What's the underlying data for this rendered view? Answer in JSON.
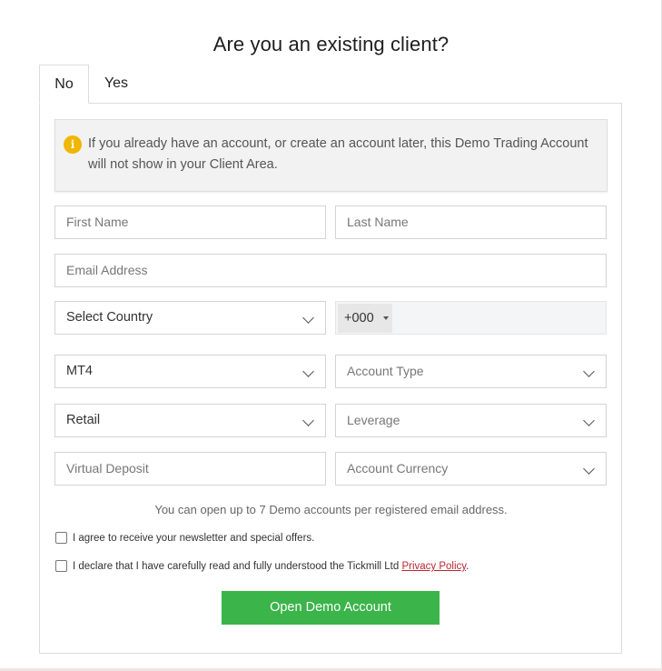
{
  "title": "Are you an existing client?",
  "tabs": {
    "no": "No",
    "yes": "Yes"
  },
  "notice": {
    "icon": "info-icon",
    "icon_glyph": "i",
    "text": "If you already have an account, or create an account later, this Demo Trading Account will not show in your Client Area."
  },
  "form": {
    "first_name_placeholder": "First Name",
    "last_name_placeholder": "Last Name",
    "email_placeholder": "Email Address",
    "country_value": "Select Country",
    "phone_prefix": "+000",
    "platform_value": "MT4",
    "account_type_value": "Account Type",
    "client_type_value": "Retail",
    "leverage_value": "Leverage",
    "virtual_deposit_placeholder": "Virtual Deposit",
    "account_currency_value": "Account Currency"
  },
  "demo_note": "You can open up to 7 Demo accounts per registered email address.",
  "checkboxes": {
    "newsletter": "I agree to receive your newsletter and special offers.",
    "declare_prefix": "I declare that I have carefully read and fully understood the Tickmill Ltd ",
    "privacy_link": "Privacy Policy",
    "declare_suffix": "."
  },
  "submit_label": "Open Demo Account",
  "colors": {
    "primary_button": "#3bb44a",
    "info_icon": "#f1b600",
    "link": "#b8292f"
  }
}
